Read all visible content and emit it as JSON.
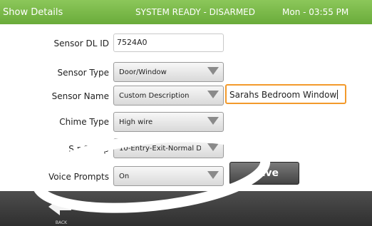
{
  "header": {
    "title": "Show Details",
    "status": "SYSTEM READY - DISARMED",
    "datetime": "Mon - 03:55 PM"
  },
  "form": {
    "dl_id": {
      "label": "Sensor DL ID",
      "value": "7524A0"
    },
    "sensor_type": {
      "label": "Sensor Type",
      "value": "Door/Window"
    },
    "sensor_name": {
      "label": "Sensor Name",
      "value": "Custom Description",
      "custom_text": "Sarahs Bedroom Window"
    },
    "chime_type": {
      "label": "Chime Type",
      "value": "High wire"
    },
    "sensor_group": {
      "label": "Sensor Group",
      "visible_label": "S  r Group",
      "value": "10-Entry-Exit-Normal De"
    },
    "voice_prompts": {
      "label": "Voice Prompts",
      "value": "On"
    }
  },
  "buttons": {
    "save": "Save",
    "save_visible": "ave"
  },
  "footer": {
    "back_label": "BACK"
  },
  "colors": {
    "header_green": "#7ab84a",
    "input_focus": "#f39a2b",
    "footer": "#3a3a3a"
  }
}
